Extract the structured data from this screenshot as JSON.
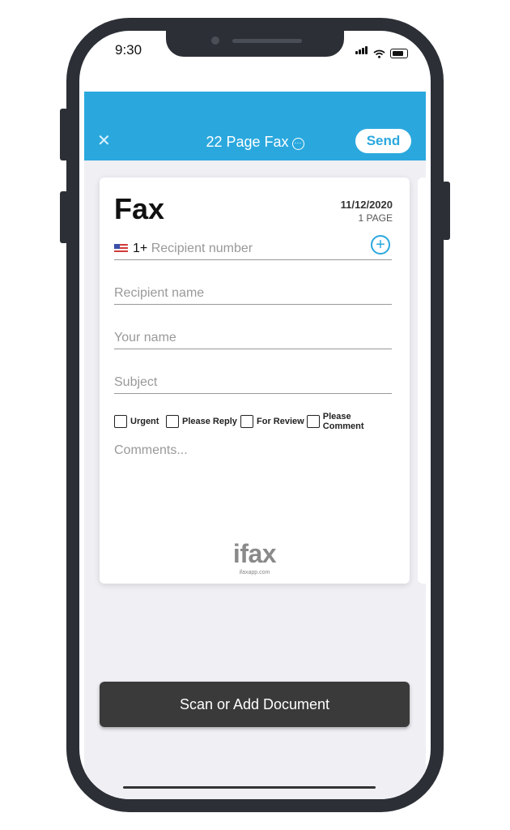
{
  "status_bar": {
    "time": "9:30"
  },
  "header": {
    "title": "22 Page Fax",
    "send_label": "Send"
  },
  "card": {
    "title": "Fax",
    "date": "11/12/2020",
    "page_count": "1 PAGE",
    "recipient_number": {
      "country_code": "1+",
      "placeholder": "Recipient number"
    },
    "recipient_name_placeholder": "Recipient name",
    "your_name_placeholder": "Your name",
    "subject_placeholder": "Subject",
    "checkboxes": [
      "Urgent",
      "Please Reply",
      "For Review",
      "Please Comment"
    ],
    "comments_placeholder": "Comments...",
    "logo_text": "ifax",
    "logo_url": "ifaxapp.com"
  },
  "scan_button_label": "Scan or Add Document",
  "colors": {
    "accent": "#2aa8de",
    "dark_button": "#3a3a3a",
    "background": "#efeff4"
  },
  "icons": {
    "close": "close-icon",
    "more": "more-circle-icon",
    "add": "plus-circle-icon",
    "flag": "us-flag-icon"
  }
}
